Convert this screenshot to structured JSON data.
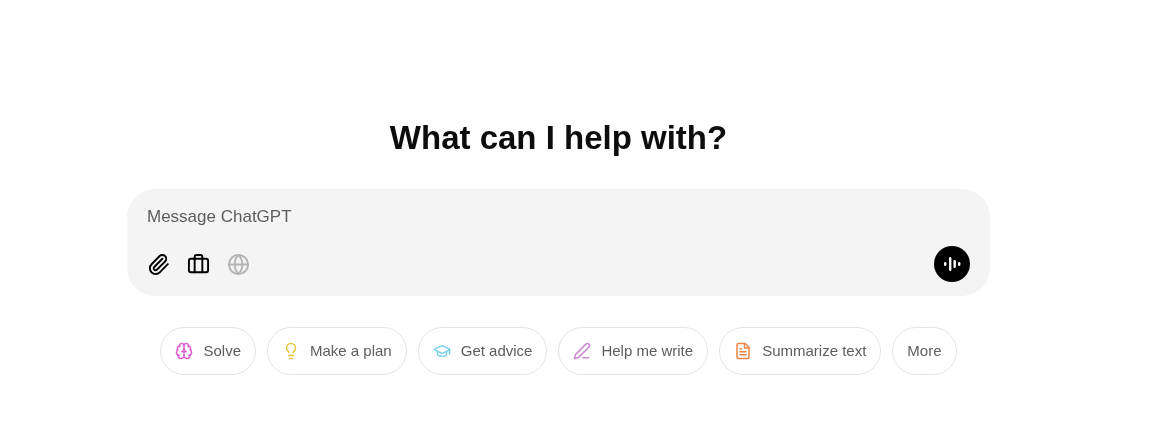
{
  "heading": "What can I help with?",
  "composer": {
    "placeholder": "Message ChatGPT",
    "tools": [
      {
        "kind": "attach",
        "disabled": false
      },
      {
        "kind": "toolbox",
        "disabled": false
      },
      {
        "kind": "globe",
        "disabled": true
      }
    ]
  },
  "suggestions": [
    {
      "label": "Solve",
      "kind": "brain",
      "color": "#e05fd0"
    },
    {
      "label": "Make a plan",
      "kind": "bulb",
      "color": "#e2c541"
    },
    {
      "label": "Get advice",
      "kind": "cap",
      "color": "#76d0eb"
    },
    {
      "label": "Help me write",
      "kind": "pen",
      "color": "#cb8bd0"
    },
    {
      "label": "Summarize text",
      "kind": "doc",
      "color": "#ea8444"
    },
    {
      "label": "More",
      "kind": "none"
    }
  ]
}
